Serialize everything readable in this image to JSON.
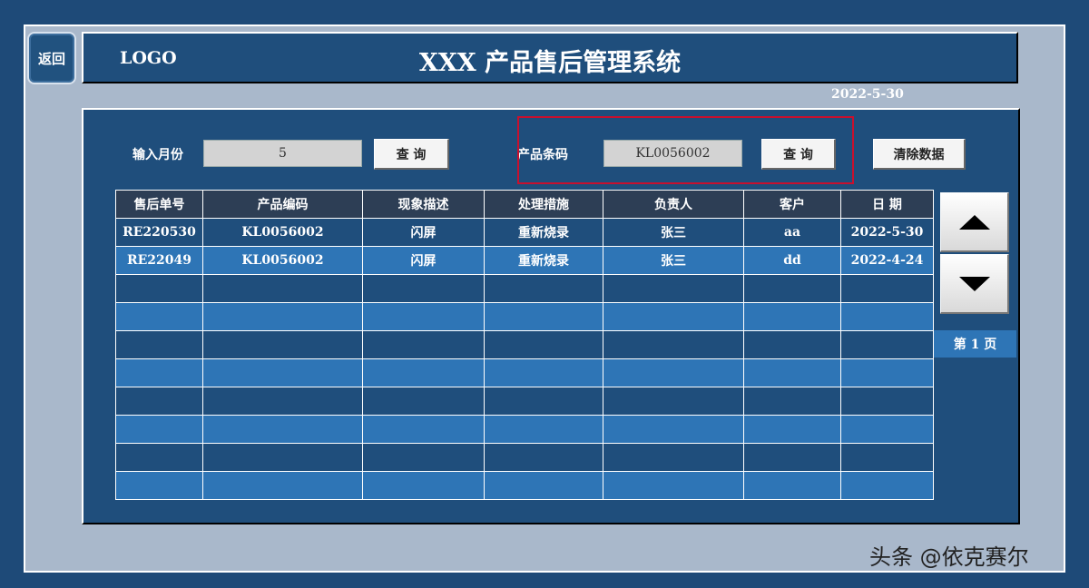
{
  "back_label": "返回",
  "header": {
    "logo": "LOGO",
    "title": "XXX 产品售后管理系统"
  },
  "date": "2022-5-30",
  "search": {
    "month_label": "输入月份",
    "month_value": "5",
    "month_query": "查 询",
    "barcode_label": "产品条码",
    "barcode_value": "KL0056002",
    "barcode_query": "查 询",
    "clear": "清除数据"
  },
  "table": {
    "columns": [
      "售后单号",
      "产品编码",
      "现象描述",
      "处理措施",
      "负责人",
      "客户",
      "日 期"
    ],
    "rows": [
      [
        "RE220530",
        "KL0056002",
        "闪屏",
        "重新烧录",
        "张三",
        "aa",
        "2022-5-30"
      ],
      [
        "RE22049",
        "KL0056002",
        "闪屏",
        "重新烧录",
        "张三",
        "dd",
        "2022-4-24"
      ],
      [
        "",
        "",
        "",
        "",
        "",
        "",
        ""
      ],
      [
        "",
        "",
        "",
        "",
        "",
        "",
        ""
      ],
      [
        "",
        "",
        "",
        "",
        "",
        "",
        ""
      ],
      [
        "",
        "",
        "",
        "",
        "",
        "",
        ""
      ],
      [
        "",
        "",
        "",
        "",
        "",
        "",
        ""
      ],
      [
        "",
        "",
        "",
        "",
        "",
        "",
        ""
      ],
      [
        "",
        "",
        "",
        "",
        "",
        "",
        ""
      ],
      [
        "",
        "",
        "",
        "",
        "",
        "",
        ""
      ]
    ]
  },
  "pager": {
    "page_label": "第 1 页",
    "up_icon": "triangle-up-icon",
    "down_icon": "triangle-down-icon"
  },
  "watermark": "头条 @依克赛尔",
  "colors": {
    "background": "#1e4a78",
    "panel": "#1f4e7c",
    "row_light": "#2e75b6",
    "header_row": "#2d3e55",
    "highlight": "#c8102e"
  }
}
